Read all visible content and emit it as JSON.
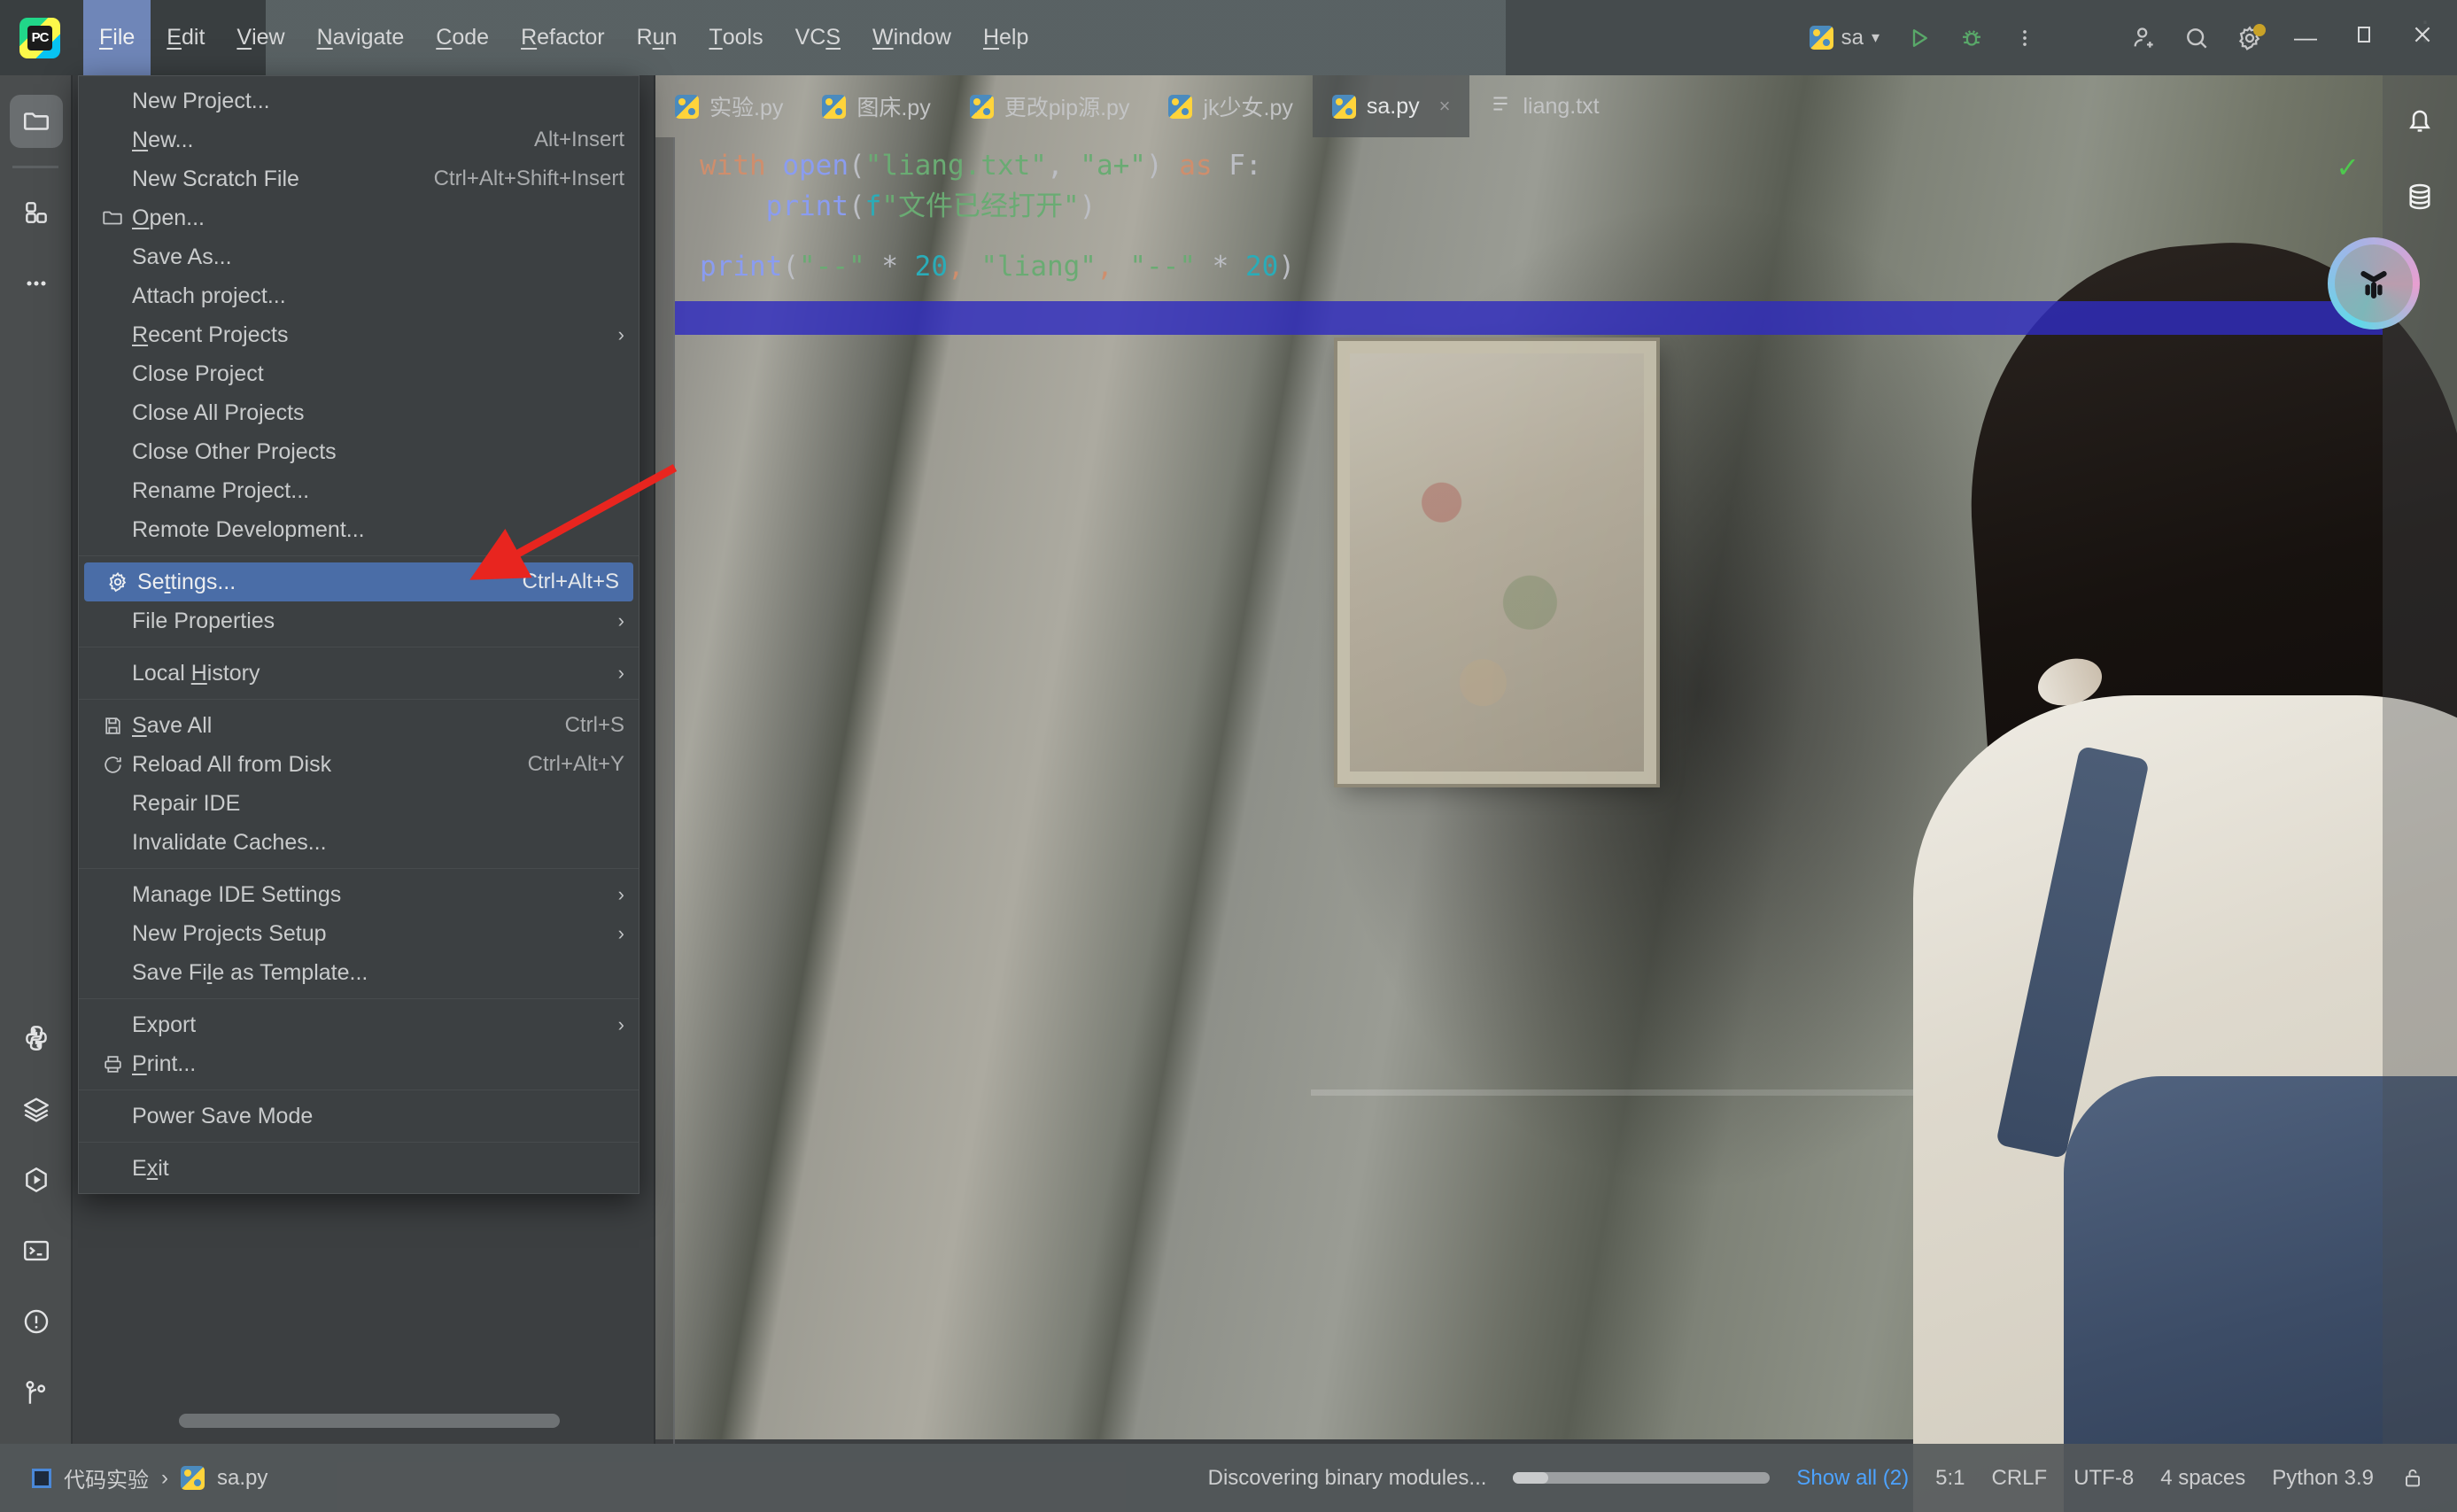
{
  "window": {
    "app_logo_text": "PC",
    "menubar": [
      {
        "label": "File",
        "mnemonic": "F",
        "active": true
      },
      {
        "label": "Edit",
        "mnemonic": "E",
        "active": false
      },
      {
        "label": "View",
        "mnemonic": "V",
        "active": false
      },
      {
        "label": "Navigate",
        "mnemonic": "N",
        "active": false
      },
      {
        "label": "Code",
        "mnemonic": "C",
        "active": false
      },
      {
        "label": "Refactor",
        "mnemonic": "R",
        "active": false
      },
      {
        "label": "Run",
        "mnemonic": "u",
        "active": false
      },
      {
        "label": "Tools",
        "mnemonic": "T",
        "active": false
      },
      {
        "label": "VCS",
        "mnemonic": "S",
        "active": false
      },
      {
        "label": "Window",
        "mnemonic": "W",
        "active": false
      },
      {
        "label": "Help",
        "mnemonic": "H",
        "active": false
      }
    ],
    "run_config": "sa",
    "toolbar_icons": [
      "run-icon",
      "debug-icon",
      "more-options-icon",
      "add-user-icon",
      "search-icon",
      "settings-gear-icon"
    ],
    "window_controls": [
      "minimize",
      "maximize",
      "close"
    ]
  },
  "file_menu": {
    "items": [
      {
        "label": "New Project...",
        "shortcut": "",
        "icon": "",
        "submenu": false,
        "highlighted": false,
        "mnemonic": ""
      },
      {
        "label": "New...",
        "shortcut": "Alt+Insert",
        "icon": "",
        "submenu": false,
        "highlighted": false,
        "mnemonic": "N"
      },
      {
        "label": "New Scratch File",
        "shortcut": "Ctrl+Alt+Shift+Insert",
        "icon": "",
        "submenu": false,
        "highlighted": false,
        "mnemonic": ""
      },
      {
        "label": "Open...",
        "shortcut": "",
        "icon": "folder-icon",
        "submenu": false,
        "highlighted": false,
        "mnemonic": "O"
      },
      {
        "label": "Save As...",
        "shortcut": "",
        "icon": "",
        "submenu": false,
        "highlighted": false,
        "mnemonic": ""
      },
      {
        "label": "Attach project...",
        "shortcut": "",
        "icon": "",
        "submenu": false,
        "highlighted": false,
        "mnemonic": ""
      },
      {
        "label": "Recent Projects",
        "shortcut": "",
        "icon": "",
        "submenu": true,
        "highlighted": false,
        "mnemonic": "R"
      },
      {
        "label": "Close Project",
        "shortcut": "",
        "icon": "",
        "submenu": false,
        "highlighted": false,
        "mnemonic": ""
      },
      {
        "label": "Close All Projects",
        "shortcut": "",
        "icon": "",
        "submenu": false,
        "highlighted": false,
        "mnemonic": ""
      },
      {
        "label": "Close Other Projects",
        "shortcut": "",
        "icon": "",
        "submenu": false,
        "highlighted": false,
        "mnemonic": ""
      },
      {
        "label": "Rename Project...",
        "shortcut": "",
        "icon": "",
        "submenu": false,
        "highlighted": false,
        "mnemonic": ""
      },
      {
        "separator_after": true,
        "label": "Remote Development...",
        "shortcut": "",
        "icon": "",
        "submenu": false,
        "highlighted": false,
        "mnemonic": ""
      },
      {
        "label": "Settings...",
        "shortcut": "Ctrl+Alt+S",
        "icon": "gear-icon",
        "submenu": false,
        "highlighted": true,
        "mnemonic": "t"
      },
      {
        "separator_after": true,
        "label": "File Properties",
        "shortcut": "",
        "icon": "",
        "submenu": true,
        "highlighted": false,
        "mnemonic": ""
      },
      {
        "separator_after": true,
        "label": "Local History",
        "shortcut": "",
        "icon": "",
        "submenu": true,
        "highlighted": false,
        "mnemonic": "H"
      },
      {
        "label": "Save All",
        "shortcut": "Ctrl+S",
        "icon": "save-icon",
        "submenu": false,
        "highlighted": false,
        "mnemonic": "S"
      },
      {
        "label": "Reload All from Disk",
        "shortcut": "Ctrl+Alt+Y",
        "icon": "reload-icon",
        "submenu": false,
        "highlighted": false,
        "mnemonic": ""
      },
      {
        "label": "Repair IDE",
        "shortcut": "",
        "icon": "",
        "submenu": false,
        "highlighted": false,
        "mnemonic": ""
      },
      {
        "separator_after": true,
        "label": "Invalidate Caches...",
        "shortcut": "",
        "icon": "",
        "submenu": false,
        "highlighted": false,
        "mnemonic": ""
      },
      {
        "label": "Manage IDE Settings",
        "shortcut": "",
        "icon": "",
        "submenu": true,
        "highlighted": false,
        "mnemonic": ""
      },
      {
        "label": "New Projects Setup",
        "shortcut": "",
        "icon": "",
        "submenu": true,
        "highlighted": false,
        "mnemonic": ""
      },
      {
        "separator_after": true,
        "label": "Save File as Template...",
        "shortcut": "",
        "icon": "",
        "submenu": false,
        "highlighted": false,
        "mnemonic": "l"
      },
      {
        "label": "Export",
        "shortcut": "",
        "icon": "",
        "submenu": true,
        "highlighted": false,
        "mnemonic": ""
      },
      {
        "separator_after": true,
        "label": "Print...",
        "shortcut": "",
        "icon": "print-icon",
        "submenu": false,
        "highlighted": false,
        "mnemonic": "P"
      },
      {
        "separator_after": true,
        "label": "Power Save Mode",
        "shortcut": "",
        "icon": "",
        "submenu": false,
        "highlighted": false,
        "mnemonic": ""
      },
      {
        "label": "Exit",
        "shortcut": "",
        "icon": "",
        "submenu": false,
        "highlighted": false,
        "mnemonic": "x"
      }
    ]
  },
  "editor": {
    "tabs": [
      {
        "label": "实验.py",
        "icon": "python-file-icon",
        "active": false,
        "closable": false
      },
      {
        "label": "图床.py",
        "icon": "python-file-icon",
        "active": false,
        "closable": false
      },
      {
        "label": "更改pip源.py",
        "icon": "python-file-icon",
        "active": false,
        "closable": false
      },
      {
        "label": "jk少女.py",
        "icon": "python-file-icon",
        "active": false,
        "closable": false
      },
      {
        "label": "sa.py",
        "icon": "python-file-icon",
        "active": true,
        "closable": true,
        "close_label": "×"
      },
      {
        "label": "liang.txt",
        "icon": "text-file-icon",
        "active": false,
        "closable": false
      }
    ],
    "tab_overflow_label": "⋮",
    "inspection_status": "✓",
    "code_lines": [
      [
        {
          "t": "with ",
          "c": "k"
        },
        {
          "t": "open",
          "c": "fn"
        },
        {
          "t": "(",
          "c": "p"
        },
        {
          "t": "\"liang.txt\"",
          "c": "s"
        },
        {
          "t": ", ",
          "c": "p"
        },
        {
          "t": "\"a+\"",
          "c": "s"
        },
        {
          "t": ")",
          "c": "p"
        },
        {
          "t": " as ",
          "c": "k"
        },
        {
          "t": "F:",
          "c": "p"
        }
      ],
      [
        {
          "t": "    ",
          "c": "p"
        },
        {
          "t": "print",
          "c": "fn"
        },
        {
          "t": "(",
          "c": "p"
        },
        {
          "t": "f",
          "c": "n"
        },
        {
          "t": "\"文件已经打开\"",
          "c": "s"
        },
        {
          "t": ")",
          "c": "p"
        }
      ],
      [],
      [
        {
          "t": "print",
          "c": "fn"
        },
        {
          "t": "(",
          "c": "p"
        },
        {
          "t": "\"--\"",
          "c": "s"
        },
        {
          "t": " * ",
          "c": "p"
        },
        {
          "t": "20",
          "c": "n"
        },
        {
          "t": ",",
          "c": "o"
        },
        {
          "t": " ",
          "c": "p"
        },
        {
          "t": "\"liang\"",
          "c": "s"
        },
        {
          "t": ",",
          "c": "o"
        },
        {
          "t": " ",
          "c": "p"
        },
        {
          "t": "\"--\"",
          "c": "s"
        },
        {
          "t": " * ",
          "c": "p"
        },
        {
          "t": "20",
          "c": "n"
        },
        {
          "t": ")",
          "c": "p"
        }
      ]
    ]
  },
  "left_rail": {
    "top_items": [
      {
        "name": "project-tool-window",
        "icon": "folder-icon",
        "selected": true
      },
      {
        "name": "structure-tool-window",
        "icon": "grid-icon",
        "selected": false
      },
      {
        "name": "more-tool-windows",
        "icon": "ellipsis-icon",
        "selected": false
      }
    ],
    "bottom_items": [
      {
        "name": "python-console",
        "icon": "python-icon"
      },
      {
        "name": "services",
        "icon": "layers-icon"
      },
      {
        "name": "run-tool-window",
        "icon": "run-hex-icon"
      },
      {
        "name": "terminal",
        "icon": "terminal-icon"
      },
      {
        "name": "problems",
        "icon": "warning-icon"
      },
      {
        "name": "version-control",
        "icon": "git-branch-icon"
      }
    ]
  },
  "right_rail": {
    "items": [
      {
        "name": "notifications",
        "icon": "bell-icon"
      },
      {
        "name": "database",
        "icon": "database-icon"
      }
    ],
    "ai_widget": {
      "name": "ai-assistant-widget",
      "icon": "cube-icon"
    }
  },
  "status_bar": {
    "breadcrumb": [
      "代码实验",
      "sa.py"
    ],
    "breadcrumb_separator": "›",
    "progress_text": "Discovering binary modules...",
    "show_all": "Show all (2)",
    "caret_position": "5:1",
    "line_separator": "CRLF",
    "encoding": "UTF-8",
    "indent": "4 spaces",
    "interpreter": "Python 3.9",
    "lock_icon": "read-write-lock-icon"
  },
  "colors": {
    "accent_blue": "#4a6da7",
    "annotation_red": "#e8251f",
    "selection_blue": "#302cbe",
    "link_blue": "#4da3ff",
    "menu_bg": "#3c4042"
  }
}
